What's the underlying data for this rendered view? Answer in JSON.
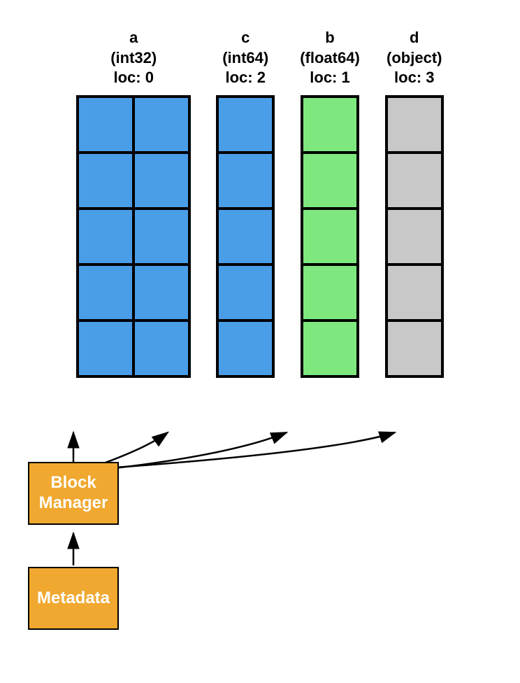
{
  "columns": [
    {
      "id": "a",
      "label": "a",
      "type": "int32",
      "loc": 0,
      "color": "blue",
      "cols": 2,
      "rows": 5
    },
    {
      "id": "c",
      "label": "c",
      "type": "int64",
      "loc": 2,
      "color": "blue",
      "cols": 1,
      "rows": 5
    },
    {
      "id": "b",
      "label": "b",
      "type": "float64",
      "loc": 1,
      "color": "green",
      "cols": 1,
      "rows": 5
    },
    {
      "id": "d",
      "label": "d",
      "type": "object",
      "loc": 3,
      "color": "gray",
      "cols": 1,
      "rows": 5
    }
  ],
  "boxes": {
    "block_manager_label": "Block\nManager",
    "metadata_label": "Metadata"
  }
}
